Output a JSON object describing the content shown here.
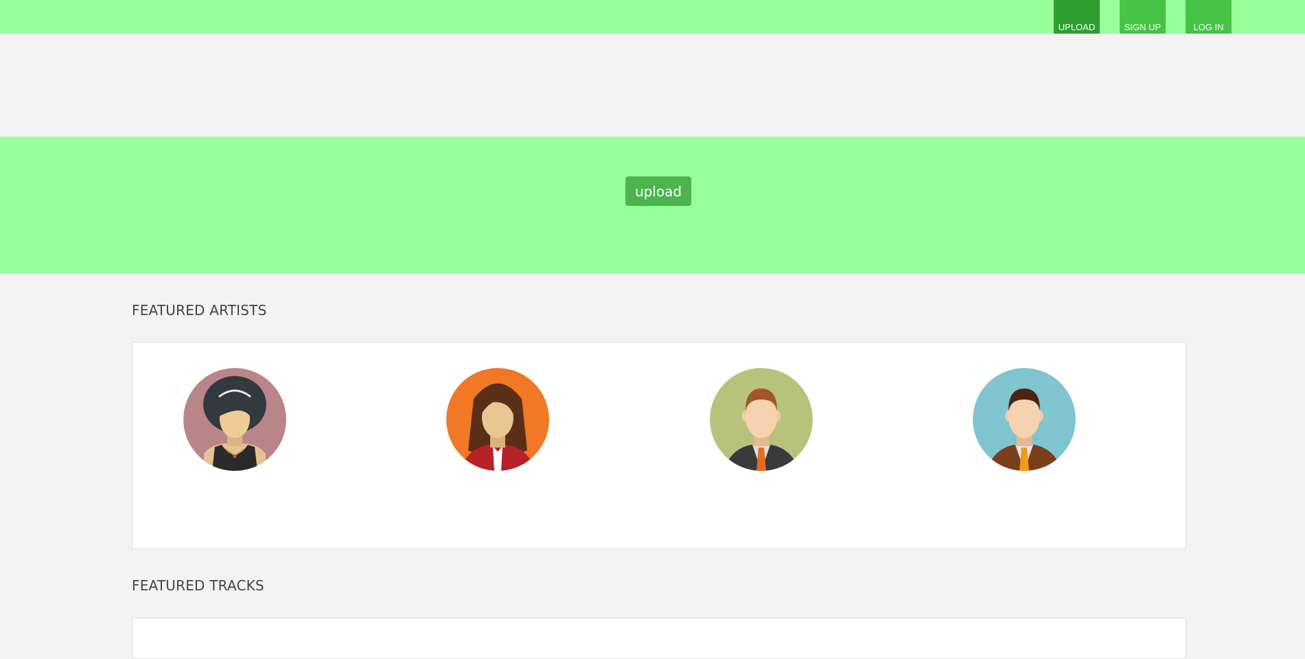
{
  "nav": {
    "upload_label": "UPLOAD",
    "signup_label": "SIGN UP",
    "login_label": "LOG IN"
  },
  "hero": {
    "upload_label": "upload"
  },
  "featured_artists": {
    "title": "FEATURED ARTISTS",
    "artists": [
      {
        "icon": "woman-black-hair-avatar-icon",
        "bg": "#b98589"
      },
      {
        "icon": "woman-brown-hair-avatar-icon",
        "bg": "#f07826"
      },
      {
        "icon": "man-suit-avatar-icon",
        "bg": "#b7c27a"
      },
      {
        "icon": "man-brown-suit-avatar-icon",
        "bg": "#80c4cf"
      }
    ]
  },
  "featured_tracks": {
    "title": "FEATURED TRACKS"
  },
  "colors": {
    "nav_bg": "#99ff99",
    "hero_bg": "#99ff99",
    "button_dark": "#2e9e2e",
    "button": "#46c446",
    "page_bg": "#f3f3f3"
  }
}
